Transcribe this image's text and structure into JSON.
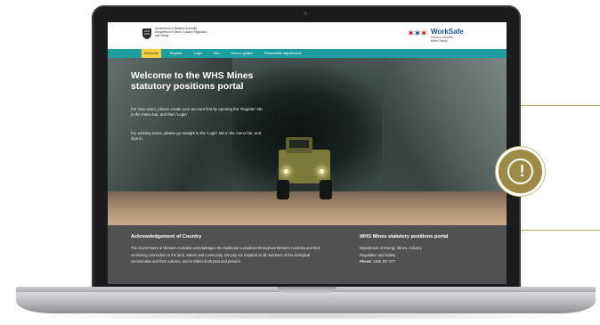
{
  "header": {
    "gov_text_lines": [
      "Government of Western Australia",
      "Department of Mines, Industry Regulation",
      "and Safety"
    ],
    "worksafe_title": "WorkSafe",
    "worksafe_sub_lines": [
      "Western Australia",
      "Mines Safety"
    ]
  },
  "nav": {
    "items": [
      "Welcome",
      "Register",
      "Login",
      "Info",
      "How-to guides",
      "Reasonable adjustments"
    ],
    "active_index": 0
  },
  "hero": {
    "title": "Welcome to the WHS Mines statutory positions portal",
    "paragraph_1": "For new users, please create your account first by opening the 'Register' tab in the menu bar, and then 'Login'.",
    "paragraph_2": "For existing users, please go straight to the 'Login' tab in the menu bar, and sign in."
  },
  "footer": {
    "ack_heading": "Acknowledgement of Country",
    "ack_text": "The Government of Western Australia acknowledges the traditional custodians throughout Western Australia and their continuing connection to the land, waters and community. We pay our respects to all members of the Aboriginal communities and their cultures, and to Elders both past and present.",
    "portal_heading": "WHS Mines statutory positions portal",
    "dept_line_1": "Department of Energy, Mines, Industry",
    "dept_line_2": "Regulation and Safety",
    "phone_label": "Phone:",
    "phone_number": "1300 307 877"
  },
  "overlay": {
    "alert_symbol": "!",
    "icon": "exclamation-circle-icon"
  },
  "colors": {
    "nav_bg": "#1f9ea0",
    "nav_active": "#f4d03f",
    "footer_bg": "#505152",
    "alert_gold": "#9c8a46",
    "callout_line": "#b9a66b",
    "worksafe_blue": "#1e4b94",
    "worksafe_red": "#c8202f"
  }
}
